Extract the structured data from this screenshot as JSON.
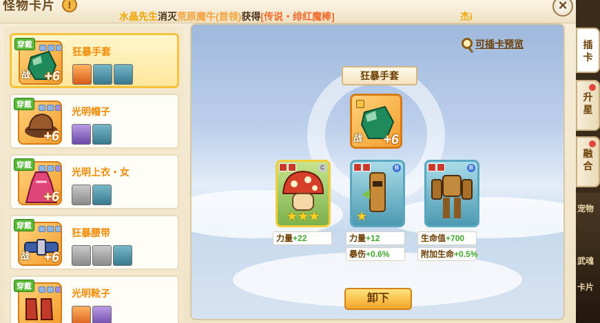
{
  "window": {
    "title": "怪物卡片",
    "info_icon": "!",
    "close_icon": "×"
  },
  "broadcast": {
    "player": "水晶先生",
    "verb": "消灭",
    "boss": "荒原魔牛(首领)",
    "got": "获得",
    "item": "[传说・绯红魔棒]",
    "tail": "杰i"
  },
  "list": [
    {
      "badge": "穿戴",
      "name": "狂暴手套",
      "level": "+6",
      "war": "战",
      "selected": true,
      "gems": [
        "blue",
        "blue",
        "blue"
      ],
      "cards": [
        "orange",
        "blue",
        "blue"
      ]
    },
    {
      "badge": "穿戴",
      "name": "光明帽子",
      "level": "+6",
      "war": "",
      "selected": false,
      "gems": [
        "blue",
        "blue",
        "purple"
      ],
      "cards": [
        "purple",
        "blue"
      ]
    },
    {
      "badge": "穿戴",
      "name": "光明上衣・女",
      "level": "+6",
      "war": "",
      "selected": false,
      "gems": [
        "blue",
        "blue",
        "purple"
      ],
      "cards": [
        "grey",
        "blue"
      ]
    },
    {
      "badge": "穿戴",
      "name": "狂暴腰带",
      "level": "+6",
      "war": "战",
      "selected": false,
      "gems": [
        "blue",
        "blue",
        "blue"
      ],
      "cards": [
        "grey",
        "grey",
        "blue"
      ]
    },
    {
      "badge": "穿戴",
      "name": "光明靴子",
      "level": "",
      "war": "",
      "selected": false,
      "gems": [
        "blue",
        "blue",
        "purple"
      ],
      "cards": [
        "orange",
        "purple"
      ]
    }
  ],
  "main": {
    "preview_link": "可插卡预览",
    "equip_name": "狂暴手套",
    "equip_level": "+6",
    "equip_war": "战",
    "unequip_label": "卸下",
    "cards": [
      {
        "rarity": "C",
        "stars": "★★★",
        "stats": [
          {
            "label": "力量",
            "value": "+22"
          }
        ]
      },
      {
        "rarity": "B",
        "stars": "★",
        "stats": [
          {
            "label": "力量",
            "value": "+12"
          },
          {
            "label": "暴伤",
            "value": "+0.6%"
          }
        ]
      },
      {
        "rarity": "B",
        "stars": "",
        "stats": [
          {
            "label": "生命值",
            "value": "+700"
          },
          {
            "label": "附加生命",
            "value": "+0.5%"
          }
        ]
      }
    ]
  },
  "tabs": [
    {
      "label": "插卡",
      "active": true
    },
    {
      "label": "升星",
      "active": false
    },
    {
      "label": "融合",
      "active": false
    }
  ],
  "side": {
    "pet": "宠物",
    "card": "卡片",
    "rank": "武魂"
  }
}
